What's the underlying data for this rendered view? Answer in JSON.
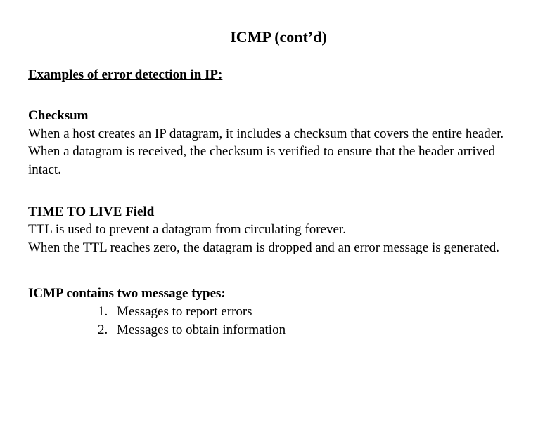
{
  "title": "ICMP (cont’d)",
  "section_heading": "Examples of error detection in IP:",
  "checksum": {
    "heading": "Checksum",
    "body": "When a host creates an IP datagram, it includes a checksum that covers the entire header. When a datagram is received, the checksum is verified to ensure that the header arrived intact."
  },
  "ttl": {
    "heading": "TIME TO LIVE Field",
    "body1": "TTL is used to prevent a datagram from circulating forever.",
    "body2": "When the TTL reaches zero, the datagram is dropped and an error message is generated."
  },
  "messages": {
    "heading": "ICMP contains two message types:",
    "items": {
      "0": "Messages to report errors",
      "1": "Messages to obtain information"
    }
  }
}
